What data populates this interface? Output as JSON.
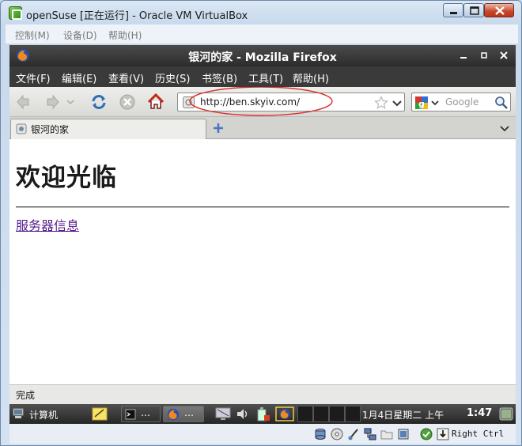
{
  "vbox": {
    "title": "openSuse [正在运行] - Oracle VM VirtualBox",
    "menu": [
      "控制(M)",
      "设备(D)",
      "帮助(H)"
    ]
  },
  "firefox": {
    "window_title": "银河的家 - Mozilla Firefox",
    "menu": [
      "文件(F)",
      "编辑(E)",
      "查看(V)",
      "历史(S)",
      "书签(B)",
      "工具(T)",
      "帮助(H)"
    ],
    "url": "http://ben.skyiv.com/",
    "search_placeholder": "Google",
    "tab_title": "银河的家",
    "status_text": "完成"
  },
  "page": {
    "heading": "欢迎光临",
    "link_text": "服务器信息"
  },
  "gnome_panel": {
    "computer_label": "计算机",
    "task_terminal_label": "…",
    "task_firefox_label": "…",
    "clock_date": "1月4日星期二 上午",
    "clock_time": "1:47"
  },
  "vbox_status": {
    "host_key_label": "Right Ctrl"
  },
  "colors": {
    "url_annotation": "#d9302a",
    "visited_link": "#551a8b",
    "firefox_chrome": "#3a3a3a"
  }
}
